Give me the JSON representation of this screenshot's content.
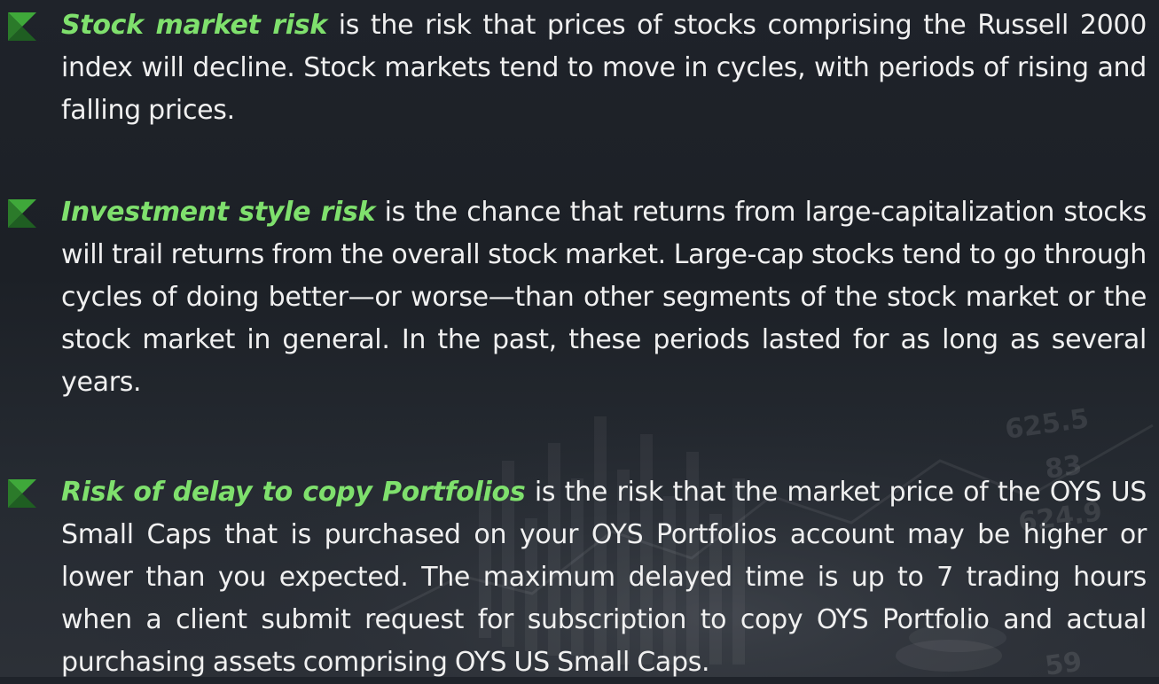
{
  "colors": {
    "accent": "#7fe06d",
    "background": "#1f232a",
    "text": "#f0f0f0",
    "marker_dark": "#1f5e22",
    "marker_light": "#3fa83a"
  },
  "icons": {
    "bullet": "green-triangle-marker-icon"
  },
  "risks": [
    {
      "term": "Stock market risk",
      "body": " is the risk that prices of stocks comprising the Russell 2000 index will decline. Stock markets tend to move in cycles, with periods of rising and falling prices."
    },
    {
      "term": "Investment style risk",
      "body": " is the chance that returns from large-capitalization stocks will trail returns from the overall stock market. Large-cap stocks tend to go through cycles of doing better—or worse—than other segments of the stock market or the stock market in general. In the past, these periods lasted for as long as several years."
    },
    {
      "term": "Risk of delay to copy Portfolios",
      "body": " is the risk  that the market price of the OYS US Small Caps  that is purchased on your OYS Portfolios account may be higher or lower than you expected. The maximum delayed time is up to 7 trading hours when a client submit request for subscription to copy OYS Portfolio and actual purchasing assets comprising OYS US Small Caps."
    }
  ],
  "background_figures": [
    "625.5",
    "83",
    "624.9",
    "59"
  ]
}
